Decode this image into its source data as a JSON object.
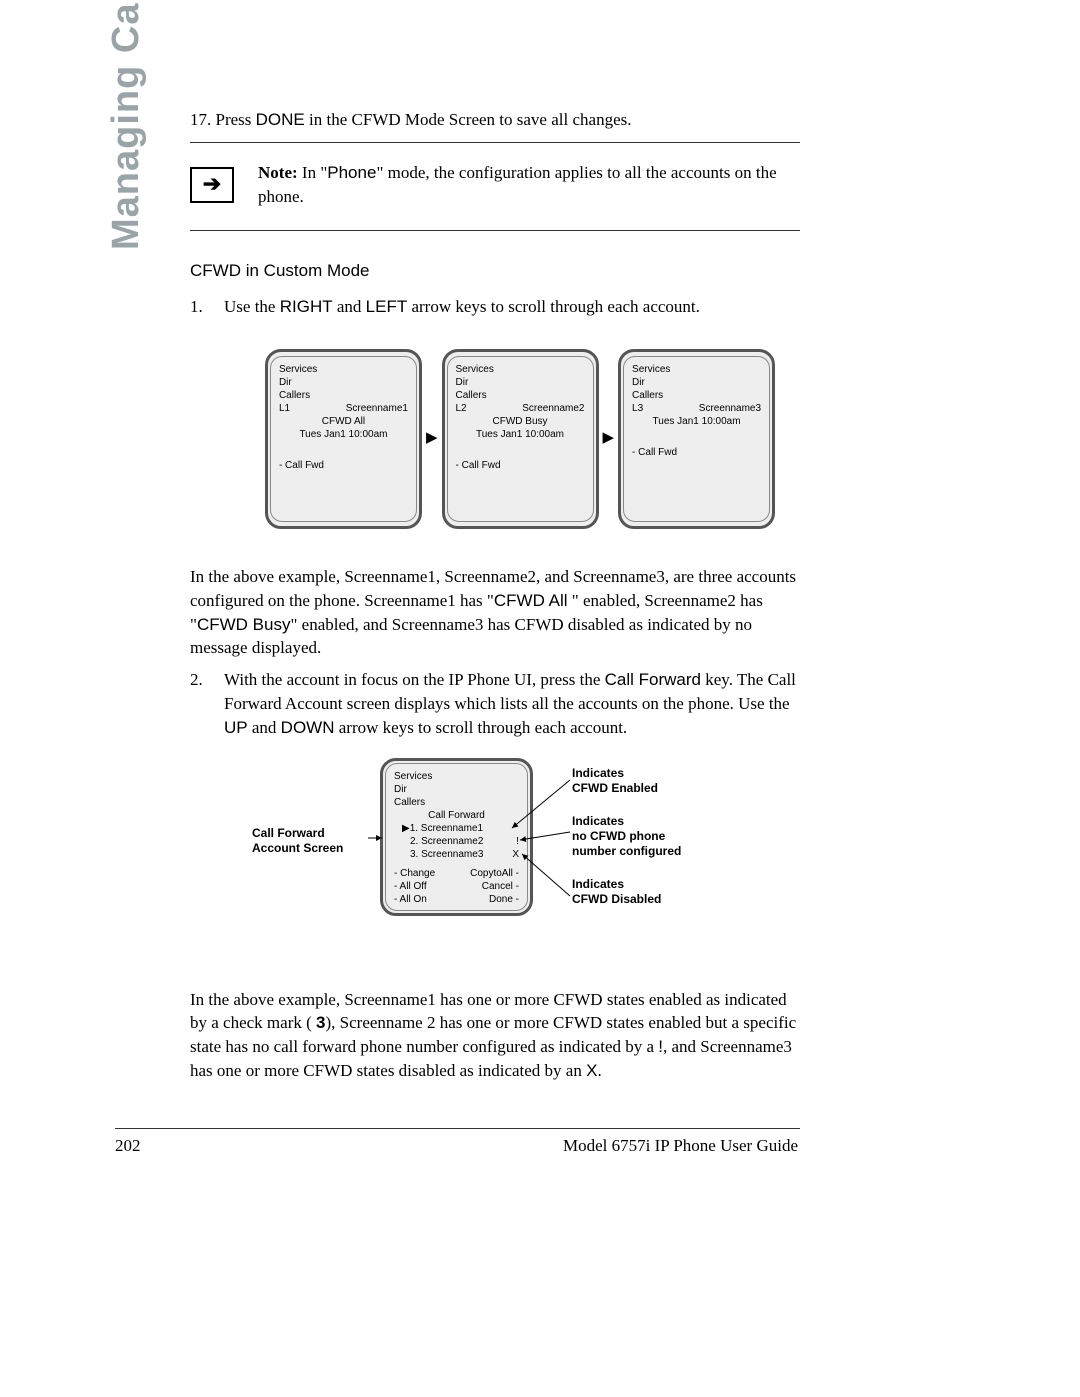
{
  "sideTitle": "Managing Calls",
  "step17": {
    "num": "17.",
    "pre": " Press ",
    "key": "DONE",
    "post": " in the CFWD Mode Screen to save all changes."
  },
  "note": {
    "label": "Note:",
    "pre": " In \"",
    "mode": "Phone",
    "post": "\" mode, the configuration applies to all the accounts on the phone."
  },
  "heading": "CFWD in Custom Mode",
  "step1": {
    "num": "1.",
    "pre": "Use the ",
    "k1": "RIGHT",
    "mid": " and ",
    "k2": "LEFT",
    "post": " arrow keys to scroll through each account."
  },
  "screens": [
    {
      "services": "Services",
      "dir": "Dir",
      "callers": "Callers",
      "line": "L1",
      "name": "Screenname1",
      "status": "CFWD All",
      "time": "Tues Jan1 10:00am",
      "softkey": "- Call Fwd"
    },
    {
      "services": "Services",
      "dir": "Dir",
      "callers": "Callers",
      "line": "L2",
      "name": "Screenname2",
      "status": "CFWD Busy",
      "time": "Tues Jan1 10:00am",
      "softkey": "- Call Fwd"
    },
    {
      "services": "Services",
      "dir": "Dir",
      "callers": "Callers",
      "line": "L3",
      "name": "Screenname3",
      "status": "",
      "time": "Tues Jan1 10:00am",
      "softkey": "- Call Fwd"
    }
  ],
  "para1": {
    "a": "In the above example, Screenname1, Screenname2, and Screenname3, are three accounts configured on the phone. Screenname1 has \"",
    "b": "CFWD All",
    "c": " \" enabled, Screenname2 has \"",
    "d": "CFWD Busy",
    "e": "\" enabled, and Screenname3 has CFWD disabled as indicated by no message displayed."
  },
  "step2": {
    "num": "2.",
    "a": "With the account in focus on the IP Phone UI, press the ",
    "b": "Call Forward",
    "c": " key. The Call Forward Account screen displays which lists all the accounts on the phone. Use the ",
    "d": "UP",
    "e": " and ",
    "f": "DOWN",
    "g": " arrow keys to scroll through each account."
  },
  "labelLeft": {
    "l1": "Call Forward",
    "l2": "Account Screen"
  },
  "acct": {
    "services": "Services",
    "dir": "Dir",
    "callers": "Callers",
    "title": "Call Forward",
    "r1": "▶1. Screenname1",
    "r2l": "2. Screenname2",
    "r2r": "!",
    "r3l": "3. Screenname3",
    "r3r": "X",
    "b1l": "- Change",
    "b1r": "CopytoAll -",
    "b2l": "- All Off",
    "b2r": "Cancel -",
    "b3l": "- All On",
    "b3r": "Done -"
  },
  "rlabels": {
    "g1a": "Indicates",
    "g1b": "CFWD Enabled",
    "g2a": "Indicates",
    "g2b": "no CFWD phone",
    "g2c": "number configured",
    "g3a": "Indicates",
    "g3b": "CFWD Disabled"
  },
  "para2": {
    "a": "In the above example, Screenname1 has one or more CFWD states enabled as indicated by a check mark ( ",
    "b": "3",
    "c": "), Screenname 2 has one or more CFWD states enabled but a specific state has no call forward phone number configured as indicated by a ",
    "d": "!",
    "e": ", and Screenname3 has one or more CFWD states disabled as indicated by an ",
    "f": "X",
    "g": "."
  },
  "footer": {
    "page": "202",
    "model": "Model 6757i IP Phone User Guide"
  }
}
